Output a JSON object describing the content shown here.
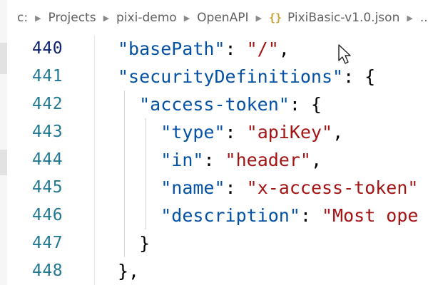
{
  "breadcrumb": {
    "items": [
      "c:",
      "Projects",
      "pixi-demo",
      "OpenAPI"
    ],
    "file_icon": "{}",
    "file_name": "PixiBasic-v1.0.json",
    "ellipsis": "..."
  },
  "editor": {
    "active_line": 440,
    "lines": [
      {
        "number": "440",
        "tokens": [
          {
            "t": "k",
            "v": "\"basePath\""
          },
          {
            "t": "p",
            "v": ": "
          },
          {
            "t": "s",
            "v": "\"/\""
          },
          {
            "t": "p",
            "v": ","
          }
        ]
      },
      {
        "number": "441",
        "tokens": [
          {
            "t": "k",
            "v": "\"securityDefinitions\""
          },
          {
            "t": "p",
            "v": ": {"
          }
        ]
      },
      {
        "number": "442",
        "tokens": [
          {
            "t": "k",
            "v": "\"access-token\""
          },
          {
            "t": "p",
            "v": ": {"
          }
        ]
      },
      {
        "number": "443",
        "tokens": [
          {
            "t": "k",
            "v": "\"type\""
          },
          {
            "t": "p",
            "v": ": "
          },
          {
            "t": "s",
            "v": "\"apiKey\""
          },
          {
            "t": "p",
            "v": ","
          }
        ]
      },
      {
        "number": "444",
        "tokens": [
          {
            "t": "k",
            "v": "\"in\""
          },
          {
            "t": "p",
            "v": ": "
          },
          {
            "t": "s",
            "v": "\"header\""
          },
          {
            "t": "p",
            "v": ","
          }
        ]
      },
      {
        "number": "445",
        "tokens": [
          {
            "t": "k",
            "v": "\"name\""
          },
          {
            "t": "p",
            "v": ": "
          },
          {
            "t": "s",
            "v": "\"x-access-token\""
          }
        ]
      },
      {
        "number": "446",
        "tokens": [
          {
            "t": "k",
            "v": "\"description\""
          },
          {
            "t": "p",
            "v": ": "
          },
          {
            "t": "s",
            "v": "\"Most ope"
          }
        ]
      },
      {
        "number": "447",
        "tokens": [
          {
            "t": "p",
            "v": "}"
          }
        ]
      },
      {
        "number": "448",
        "tokens": [
          {
            "t": "p",
            "v": "},"
          }
        ]
      }
    ]
  },
  "colors": {
    "key": "#0451a5",
    "string": "#a31515",
    "line_number": "#237893",
    "active_line_number": "#0b216f",
    "json_icon": "#cba135"
  }
}
